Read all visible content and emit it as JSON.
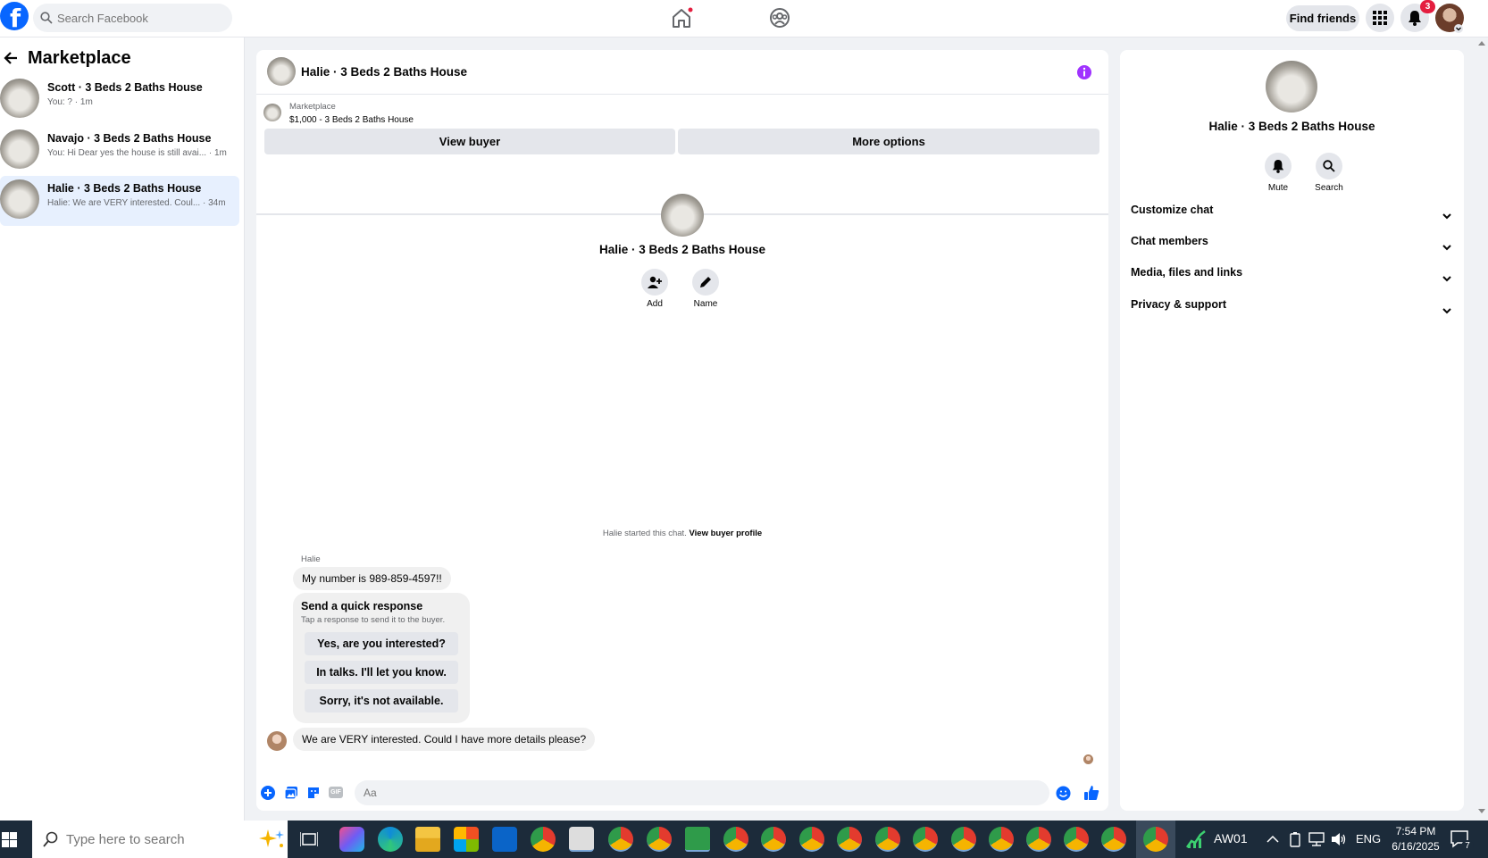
{
  "topbar": {
    "search_placeholder": "Search Facebook",
    "find_friends_label": "Find friends",
    "notification_count": "3"
  },
  "left": {
    "title": "Marketplace",
    "conversations": [
      {
        "name": "Scott · 3 Beds 2 Baths House",
        "preview": "You: ? · 1m"
      },
      {
        "name": "Navajo · 3 Beds 2 Baths House",
        "preview": "You: Hi Dear yes the house is still avai... · 1m"
      },
      {
        "name": "Halie · 3 Beds 2 Baths House",
        "preview": "Halie: We are VERY interested. Coul... · 34m"
      }
    ]
  },
  "chat": {
    "header_title": "Halie · 3 Beds 2 Baths House",
    "listing_label": "Marketplace",
    "listing_title": "$1,000 - 3 Beds 2 Baths House",
    "view_buyer_label": "View buyer",
    "more_options_label": "More options",
    "profile_name": "Halie · 3 Beds 2 Baths House",
    "add_label": "Add",
    "name_label": "Name",
    "started_text": "Halie started this chat.",
    "view_profile_link": "View buyer profile",
    "sender_name": "Halie",
    "message_1": "My number is 989-859-4597!!",
    "quick_title": "Send a quick response",
    "quick_subtitle": "Tap a response to send it to the buyer.",
    "quick_responses": [
      "Yes, are you interested?",
      "In talks. I'll let you know.",
      "Sorry, it's not available."
    ],
    "message_2": "We are VERY interested. Could I have more details please?",
    "composer_placeholder": "Aa",
    "gif_label": "GIF"
  },
  "right": {
    "name": "Halie · 3 Beds 2 Baths House",
    "mute_label": "Mute",
    "search_label": "Search",
    "sections": [
      "Customize chat",
      "Chat members",
      "Media, files and links",
      "Privacy & support"
    ]
  },
  "taskbar": {
    "search_placeholder": "Type here to search",
    "weather_label": "AW01",
    "language": "ENG",
    "time": "7:54 PM",
    "date": "6/16/2025",
    "notifications_count": "7"
  },
  "colors": {
    "facebook_blue": "#0866ff",
    "messenger_purple": "#a033ff",
    "badge_red": "#e41e3f",
    "taskbar_bg": "#1c2b3a"
  }
}
